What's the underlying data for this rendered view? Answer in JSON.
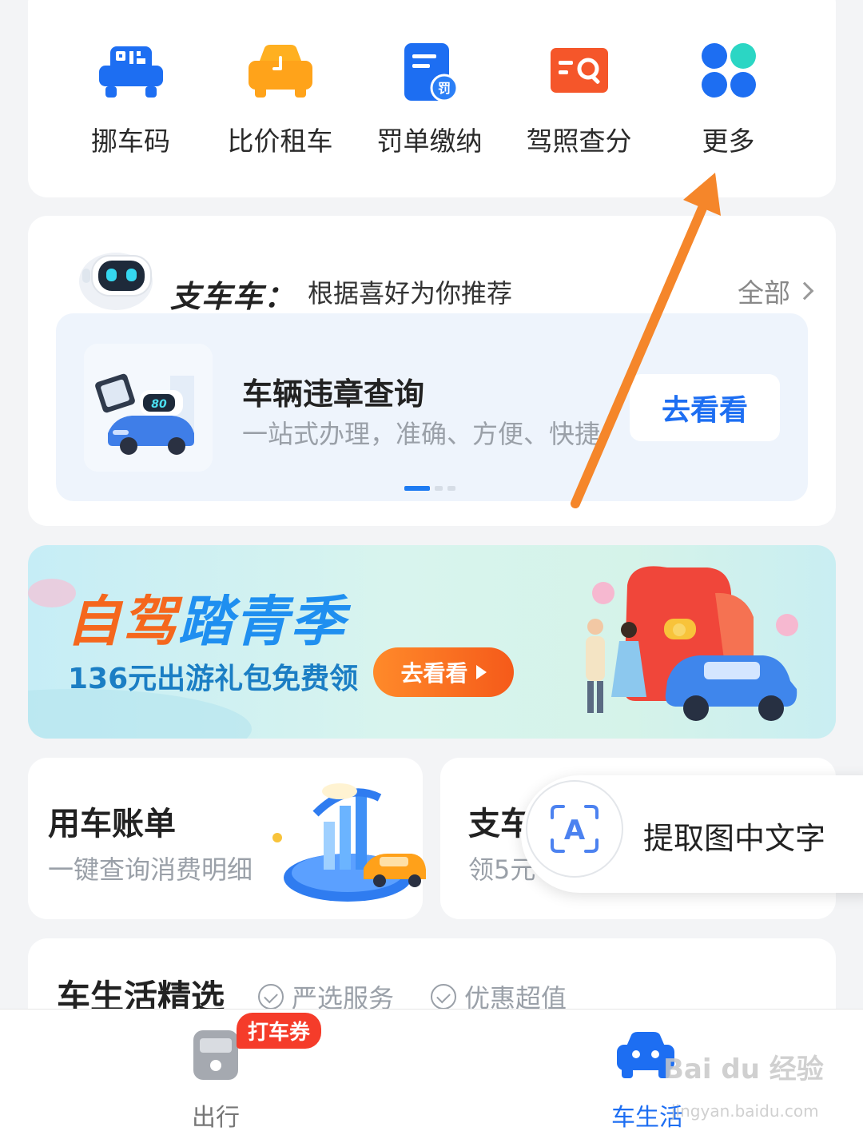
{
  "services": [
    {
      "label": "挪车码",
      "icon": "parking-qr-icon"
    },
    {
      "label": "比价租车",
      "icon": "car-rental-icon"
    },
    {
      "label": "罚单缴纳",
      "icon": "ticket-fine-icon"
    },
    {
      "label": "驾照查分",
      "icon": "license-search-icon"
    },
    {
      "label": "更多",
      "icon": "more-grid-icon"
    }
  ],
  "recommend": {
    "brand": "支车车",
    "subtitle": "根据喜好为你推荐",
    "all_link": "全部",
    "item": {
      "title": "车辆违章查询",
      "desc": "一站式办理，准确、方便、快捷",
      "button": "去看看",
      "speed": "80"
    },
    "pager": {
      "count": 3,
      "active": 0
    }
  },
  "banner": {
    "title_part1": "自驾",
    "title_part2": "踏青季",
    "subtitle": "136元出游礼包免费领",
    "button": "去看看"
  },
  "bill_card": {
    "title": "用车账单",
    "desc": "一键查询消费明细"
  },
  "zhi_card": {
    "title": "支车",
    "desc": "领5元"
  },
  "ocr_popup": {
    "label": "提取图中文字",
    "icon_letter": "A"
  },
  "selection": {
    "title": "车生活精选",
    "tags": [
      "严选服务",
      "优惠超值"
    ]
  },
  "bottom_nav": {
    "items": [
      {
        "label": "出行",
        "active": false
      },
      {
        "label": "车生活",
        "active": true
      }
    ],
    "coupon_badge": "打车券"
  },
  "watermark": {
    "text": "Bai du 经验",
    "sub": "jingyan.baidu.com"
  },
  "colors": {
    "primary": "#1d6ef2",
    "orange": "#f5671d",
    "badge_red": "#f53c2a",
    "annotation_arrow": "#f5862a"
  }
}
